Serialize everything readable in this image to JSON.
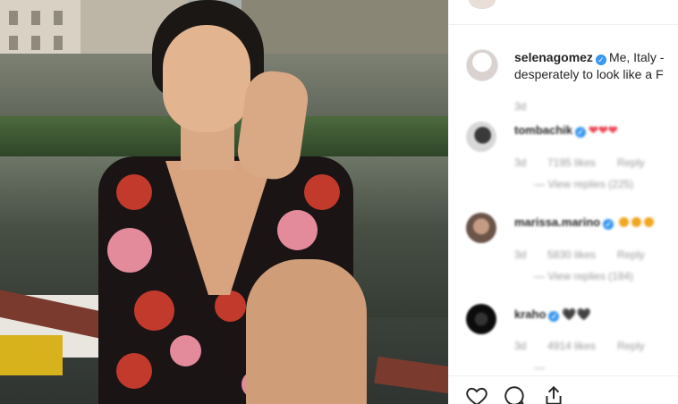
{
  "post": {
    "caption_username": "selenagomez",
    "caption_text": "Me, Italy -",
    "caption_text_line2": "desperately to look like a F",
    "caption_time": "3d"
  },
  "comments": [
    {
      "username": "tombachik",
      "hearts": "❤❤❤",
      "time": "3d",
      "likes": "7195 likes",
      "reply": "Reply",
      "view_replies": "View replies (225)"
    },
    {
      "username": "marissa.marino",
      "time": "3d",
      "likes": "5830 likes",
      "reply": "Reply",
      "view_replies": "View replies (184)"
    },
    {
      "username": "kraho",
      "hearts": "🖤🖤",
      "time": "3d",
      "likes": "4914 likes",
      "reply": "Reply"
    }
  ],
  "colors": {
    "verified_blue": "#3897f0",
    "heart_red": "#ed4956",
    "text_dark": "#262626",
    "text_grey": "#999999"
  },
  "icons": [
    "like-heart-icon",
    "comment-icon",
    "share-icon"
  ]
}
